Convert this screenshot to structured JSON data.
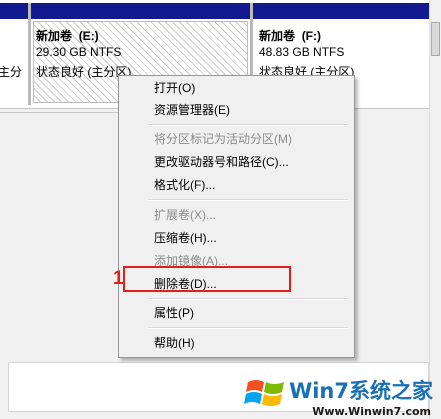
{
  "left_partition": {
    "label_fragment": "主分"
  },
  "partitions": [
    {
      "name": "新加卷",
      "letter": "(E:)",
      "size": "29.30 GB NTFS",
      "status": "状态良好 (主分区)"
    },
    {
      "name": "新加卷",
      "letter": "(F:)",
      "size": "48.83 GB NTFS",
      "status": "状态良好 (主分区)"
    }
  ],
  "context_menu": {
    "items": [
      {
        "label": "打开(O)",
        "enabled": true
      },
      {
        "label": "资源管理器(E)",
        "enabled": true
      },
      {
        "label": "将分区标记为活动分区(M)",
        "enabled": false
      },
      {
        "label": "更改驱动器号和路径(C)...",
        "enabled": true
      },
      {
        "label": "格式化(F)...",
        "enabled": true
      },
      {
        "label": "扩展卷(X)...",
        "enabled": false
      },
      {
        "label": "压缩卷(H)...",
        "enabled": true
      },
      {
        "label": "添加镜像(A)...",
        "enabled": false
      },
      {
        "label": "删除卷(D)...",
        "enabled": true
      },
      {
        "label": "属性(P)",
        "enabled": true
      },
      {
        "label": "帮助(H)",
        "enabled": true
      }
    ]
  },
  "annotation": {
    "number": "1",
    "color": "#e0201b"
  },
  "watermark": {
    "text": "Win7系统之家",
    "url": "Www.Winwin7.com"
  },
  "colors": {
    "partition_bar": "#131a8f",
    "accent": "#1a6fb5"
  }
}
